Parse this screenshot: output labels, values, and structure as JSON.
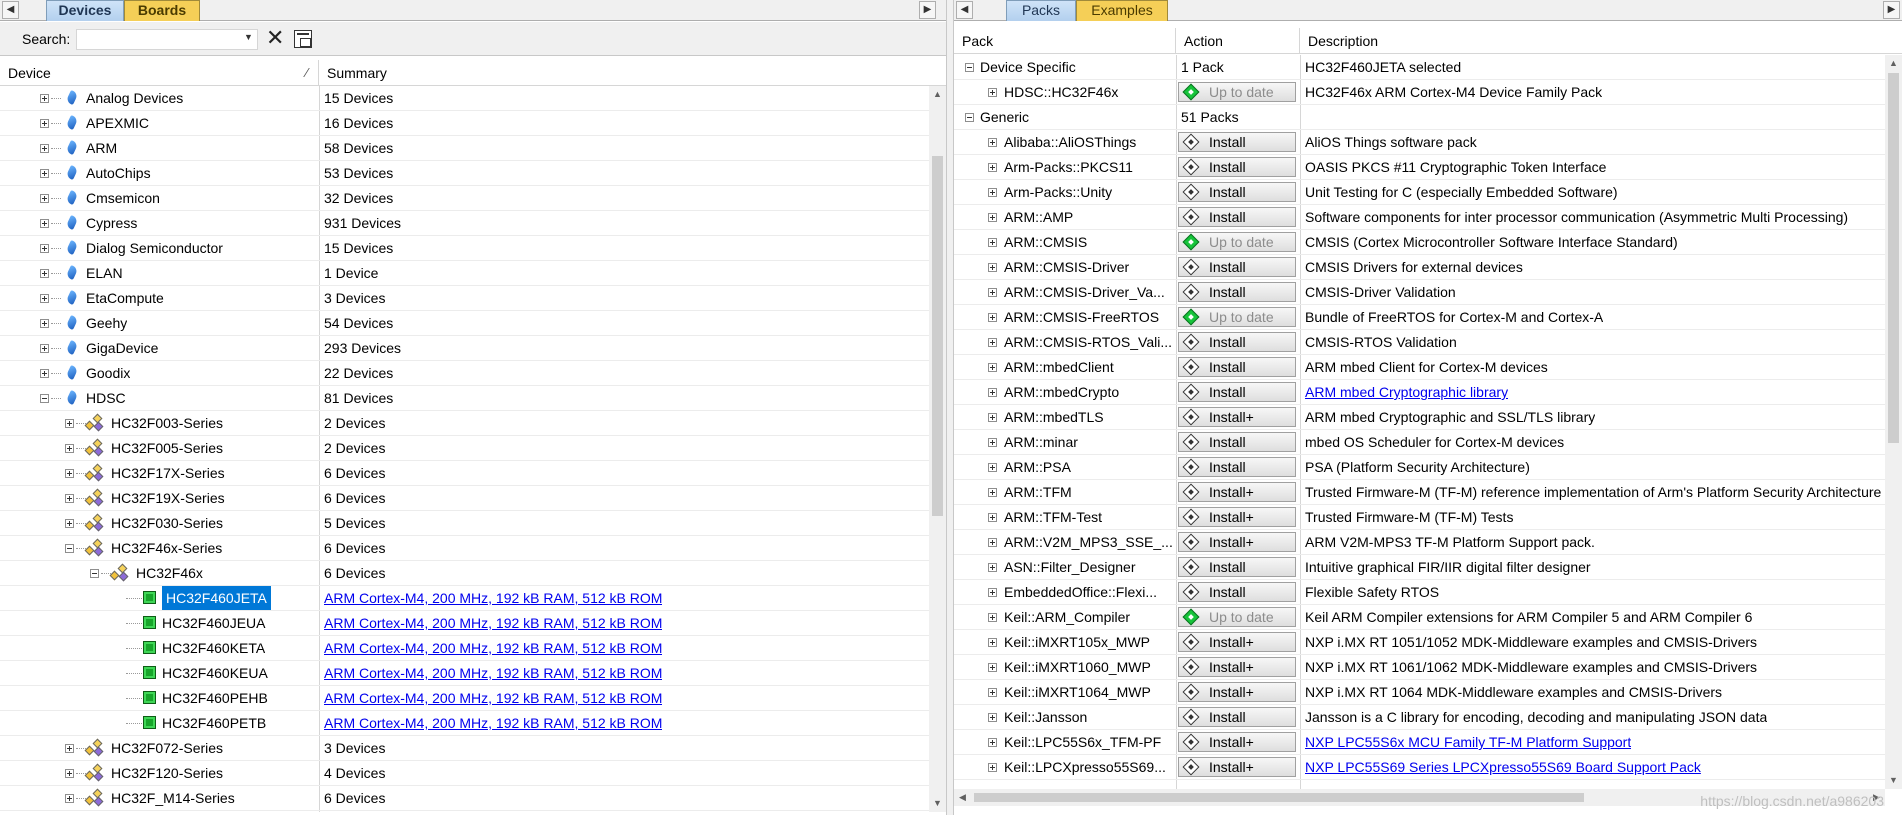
{
  "left": {
    "tabs": [
      {
        "label": "Devices",
        "active": true
      },
      {
        "label": "Boards",
        "active": false
      }
    ],
    "search": {
      "label": "Search:",
      "value": ""
    },
    "columns": {
      "device": "Device",
      "summary": "Summary"
    },
    "rows": [
      {
        "name": "Analog Devices",
        "summary": "15 Devices",
        "level": 0,
        "icon": "vendor",
        "exp": "plus"
      },
      {
        "name": "APEXMIC",
        "summary": "16 Devices",
        "level": 0,
        "icon": "vendor",
        "exp": "plus"
      },
      {
        "name": "ARM",
        "summary": "58 Devices",
        "level": 0,
        "icon": "vendor",
        "exp": "plus"
      },
      {
        "name": "AutoChips",
        "summary": "53 Devices",
        "level": 0,
        "icon": "vendor",
        "exp": "plus"
      },
      {
        "name": "Cmsemicon",
        "summary": "32 Devices",
        "level": 0,
        "icon": "vendor",
        "exp": "plus"
      },
      {
        "name": "Cypress",
        "summary": "931 Devices",
        "level": 0,
        "icon": "vendor",
        "exp": "plus"
      },
      {
        "name": "Dialog Semiconductor",
        "summary": "15 Devices",
        "level": 0,
        "icon": "vendor",
        "exp": "plus"
      },
      {
        "name": "ELAN",
        "summary": "1 Device",
        "level": 0,
        "icon": "vendor",
        "exp": "plus"
      },
      {
        "name": "EtaCompute",
        "summary": "3 Devices",
        "level": 0,
        "icon": "vendor",
        "exp": "plus"
      },
      {
        "name": "Geehy",
        "summary": "54 Devices",
        "level": 0,
        "icon": "vendor",
        "exp": "plus"
      },
      {
        "name": "GigaDevice",
        "summary": "293 Devices",
        "level": 0,
        "icon": "vendor",
        "exp": "plus"
      },
      {
        "name": "Goodix",
        "summary": "22 Devices",
        "level": 0,
        "icon": "vendor",
        "exp": "plus"
      },
      {
        "name": "HDSC",
        "summary": "81 Devices",
        "level": 0,
        "icon": "vendor",
        "exp": "minus"
      },
      {
        "name": "HC32F003-Series",
        "summary": "2 Devices",
        "level": 1,
        "icon": "family",
        "exp": "plus"
      },
      {
        "name": "HC32F005-Series",
        "summary": "2 Devices",
        "level": 1,
        "icon": "family",
        "exp": "plus"
      },
      {
        "name": "HC32F17X-Series",
        "summary": "6 Devices",
        "level": 1,
        "icon": "family",
        "exp": "plus"
      },
      {
        "name": "HC32F19X-Series",
        "summary": "6 Devices",
        "level": 1,
        "icon": "family",
        "exp": "plus"
      },
      {
        "name": "HC32F030-Series",
        "summary": "5 Devices",
        "level": 1,
        "icon": "family",
        "exp": "plus"
      },
      {
        "name": "HC32F46x-Series",
        "summary": "6 Devices",
        "level": 1,
        "icon": "family",
        "exp": "minus"
      },
      {
        "name": "HC32F46x",
        "summary": "6 Devices",
        "level": 2,
        "icon": "family",
        "exp": "minus"
      },
      {
        "name": "HC32F460JETA",
        "summary": "ARM Cortex-M4, 200 MHz, 192 kB RAM, 512 kB ROM",
        "level": 3,
        "icon": "chip",
        "exp": "",
        "link": true,
        "selected": true
      },
      {
        "name": "HC32F460JEUA",
        "summary": "ARM Cortex-M4, 200 MHz, 192 kB RAM, 512 kB ROM",
        "level": 3,
        "icon": "chip",
        "exp": "",
        "link": true
      },
      {
        "name": "HC32F460KETA",
        "summary": "ARM Cortex-M4, 200 MHz, 192 kB RAM, 512 kB ROM",
        "level": 3,
        "icon": "chip",
        "exp": "",
        "link": true
      },
      {
        "name": "HC32F460KEUA",
        "summary": "ARM Cortex-M4, 200 MHz, 192 kB RAM, 512 kB ROM",
        "level": 3,
        "icon": "chip",
        "exp": "",
        "link": true
      },
      {
        "name": "HC32F460PEHB",
        "summary": "ARM Cortex-M4, 200 MHz, 192 kB RAM, 512 kB ROM",
        "level": 3,
        "icon": "chip",
        "exp": "",
        "link": true
      },
      {
        "name": "HC32F460PETB",
        "summary": "ARM Cortex-M4, 200 MHz, 192 kB RAM, 512 kB ROM",
        "level": 3,
        "icon": "chip",
        "exp": "",
        "link": true
      },
      {
        "name": "HC32F072-Series",
        "summary": "3 Devices",
        "level": 1,
        "icon": "family",
        "exp": "plus"
      },
      {
        "name": "HC32F120-Series",
        "summary": "4 Devices",
        "level": 1,
        "icon": "family",
        "exp": "plus"
      },
      {
        "name": "HC32F_M14-Series",
        "summary": "6 Devices",
        "level": 1,
        "icon": "family",
        "exp": "plus"
      }
    ]
  },
  "right": {
    "tabs": [
      {
        "label": "Packs",
        "active": true
      },
      {
        "label": "Examples",
        "active": false
      }
    ],
    "columns": {
      "pack": "Pack",
      "action": "Action",
      "description": "Description"
    },
    "rows": [
      {
        "pack": "Device Specific",
        "action": "1 Pack",
        "desc": "HC32F460JETA selected",
        "level": 0,
        "type": "group"
      },
      {
        "pack": "HDSC::HC32F46x",
        "action": "Up to date",
        "desc": "HC32F46x ARM Cortex-M4 Device Family Pack",
        "level": 1,
        "type": "uptodate"
      },
      {
        "pack": "Generic",
        "action": "51 Packs",
        "desc": "",
        "level": 0,
        "type": "group"
      },
      {
        "pack": "Alibaba::AliOSThings",
        "action": "Install",
        "desc": "AliOS Things software pack",
        "level": 1,
        "type": "install"
      },
      {
        "pack": "Arm-Packs::PKCS11",
        "action": "Install",
        "desc": "OASIS PKCS #11 Cryptographic Token Interface",
        "level": 1,
        "type": "install"
      },
      {
        "pack": "Arm-Packs::Unity",
        "action": "Install",
        "desc": "Unit Testing for C (especially Embedded Software)",
        "level": 1,
        "type": "install"
      },
      {
        "pack": "ARM::AMP",
        "action": "Install",
        "desc": "Software components for inter processor communication (Asymmetric Multi Processing)",
        "level": 1,
        "type": "install"
      },
      {
        "pack": "ARM::CMSIS",
        "action": "Up to date",
        "desc": "CMSIS (Cortex Microcontroller Software Interface Standard)",
        "level": 1,
        "type": "uptodate"
      },
      {
        "pack": "ARM::CMSIS-Driver",
        "action": "Install",
        "desc": "CMSIS Drivers for external devices",
        "level": 1,
        "type": "install"
      },
      {
        "pack": "ARM::CMSIS-Driver_Va...",
        "action": "Install",
        "desc": "CMSIS-Driver Validation",
        "level": 1,
        "type": "install"
      },
      {
        "pack": "ARM::CMSIS-FreeRTOS",
        "action": "Up to date",
        "desc": "Bundle of FreeRTOS for Cortex-M and Cortex-A",
        "level": 1,
        "type": "uptodate"
      },
      {
        "pack": "ARM::CMSIS-RTOS_Vali...",
        "action": "Install",
        "desc": "CMSIS-RTOS Validation",
        "level": 1,
        "type": "install"
      },
      {
        "pack": "ARM::mbedClient",
        "action": "Install",
        "desc": "ARM mbed Client for Cortex-M devices",
        "level": 1,
        "type": "install"
      },
      {
        "pack": "ARM::mbedCrypto",
        "action": "Install",
        "desc": "ARM mbed Cryptographic library",
        "level": 1,
        "type": "install",
        "link": true
      },
      {
        "pack": "ARM::mbedTLS",
        "action": "Install+",
        "desc": "ARM mbed Cryptographic and SSL/TLS library",
        "level": 1,
        "type": "install"
      },
      {
        "pack": "ARM::minar",
        "action": "Install",
        "desc": "mbed OS Scheduler for Cortex-M devices",
        "level": 1,
        "type": "install"
      },
      {
        "pack": "ARM::PSA",
        "action": "Install",
        "desc": "PSA (Platform Security Architecture)",
        "level": 1,
        "type": "install"
      },
      {
        "pack": "ARM::TFM",
        "action": "Install+",
        "desc": "Trusted Firmware-M (TF-M) reference implementation of Arm's Platform Security Architecture",
        "level": 1,
        "type": "install"
      },
      {
        "pack": "ARM::TFM-Test",
        "action": "Install+",
        "desc": "Trusted Firmware-M (TF-M) Tests",
        "level": 1,
        "type": "install"
      },
      {
        "pack": "ARM::V2M_MPS3_SSE_...",
        "action": "Install+",
        "desc": "ARM V2M-MPS3 TF-M Platform Support pack.",
        "level": 1,
        "type": "install"
      },
      {
        "pack": "ASN::Filter_Designer",
        "action": "Install",
        "desc": "Intuitive graphical FIR/IIR digital filter designer",
        "level": 1,
        "type": "install"
      },
      {
        "pack": "EmbeddedOffice::Flexi...",
        "action": "Install",
        "desc": "Flexible Safety RTOS",
        "level": 1,
        "type": "install"
      },
      {
        "pack": "Keil::ARM_Compiler",
        "action": "Up to date",
        "desc": "Keil ARM Compiler extensions for ARM Compiler 5 and ARM Compiler 6",
        "level": 1,
        "type": "uptodate"
      },
      {
        "pack": "Keil::iMXRT105x_MWP",
        "action": "Install+",
        "desc": "NXP i.MX RT 1051/1052 MDK-Middleware examples and CMSIS-Drivers",
        "level": 1,
        "type": "install"
      },
      {
        "pack": "Keil::iMXRT1060_MWP",
        "action": "Install+",
        "desc": "NXP i.MX RT 1061/1062 MDK-Middleware examples and CMSIS-Drivers",
        "level": 1,
        "type": "install"
      },
      {
        "pack": "Keil::iMXRT1064_MWP",
        "action": "Install+",
        "desc": "NXP i.MX RT 1064 MDK-Middleware examples and CMSIS-Drivers",
        "level": 1,
        "type": "install"
      },
      {
        "pack": "Keil::Jansson",
        "action": "Install",
        "desc": "Jansson is a C library for encoding, decoding and manipulating JSON data",
        "level": 1,
        "type": "install"
      },
      {
        "pack": "Keil::LPC55S6x_TFM-PF",
        "action": "Install+",
        "desc": "NXP LPC55S6x MCU Family TF-M Platform Support",
        "level": 1,
        "type": "install",
        "link": true
      },
      {
        "pack": "Keil::LPCXpresso55S69...",
        "action": "Install+",
        "desc": "NXP LPC55S69 Series LPCXpresso55S69 Board Support Pack",
        "level": 1,
        "type": "install",
        "link": true
      }
    ]
  },
  "watermark": "https://blog.csdn.net/a986203"
}
